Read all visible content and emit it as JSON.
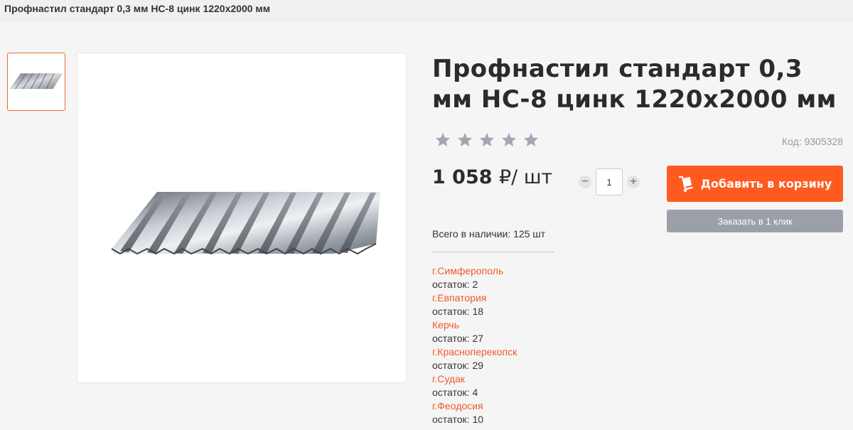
{
  "header": {
    "title": "Профнастил стандарт 0,3 мм НС-8 цинк 1220х2000 мм"
  },
  "product": {
    "title": "Профнастил стандарт 0,3 мм НС-8 цинк 1220х2000 мм",
    "sku": "Код: 9305328",
    "rating_stars": 5,
    "price_amount": "1 058",
    "price_currency": "₽",
    "price_unit": "/ шт",
    "quantity": "1",
    "add_to_cart": "Добавить в корзину",
    "one_click": "Заказать в 1 клик",
    "stock_total": "Всего в наличии: 125 шт"
  },
  "stores": [
    {
      "name": "г.Симферополь",
      "qty": "остаток: 2"
    },
    {
      "name": "г.Евпатория",
      "qty": "остаток: 18"
    },
    {
      "name": "Керчь",
      "qty": "остаток: 27"
    },
    {
      "name": "г.Красноперекопск",
      "qty": "остаток: 29"
    },
    {
      "name": "г.Судак",
      "qty": "остаток: 4"
    },
    {
      "name": "г.Феодосия",
      "qty": "остаток: 10"
    }
  ],
  "colors": {
    "accent": "#ff5a1f",
    "link": "#f05a28",
    "secondary_button": "#9b9fa9",
    "star": "#a3a7b2"
  },
  "icons": {
    "cart_button": "cart-dolly-icon",
    "rating": "star-icon",
    "qty_minus": "minus-icon",
    "qty_plus": "plus-icon"
  }
}
